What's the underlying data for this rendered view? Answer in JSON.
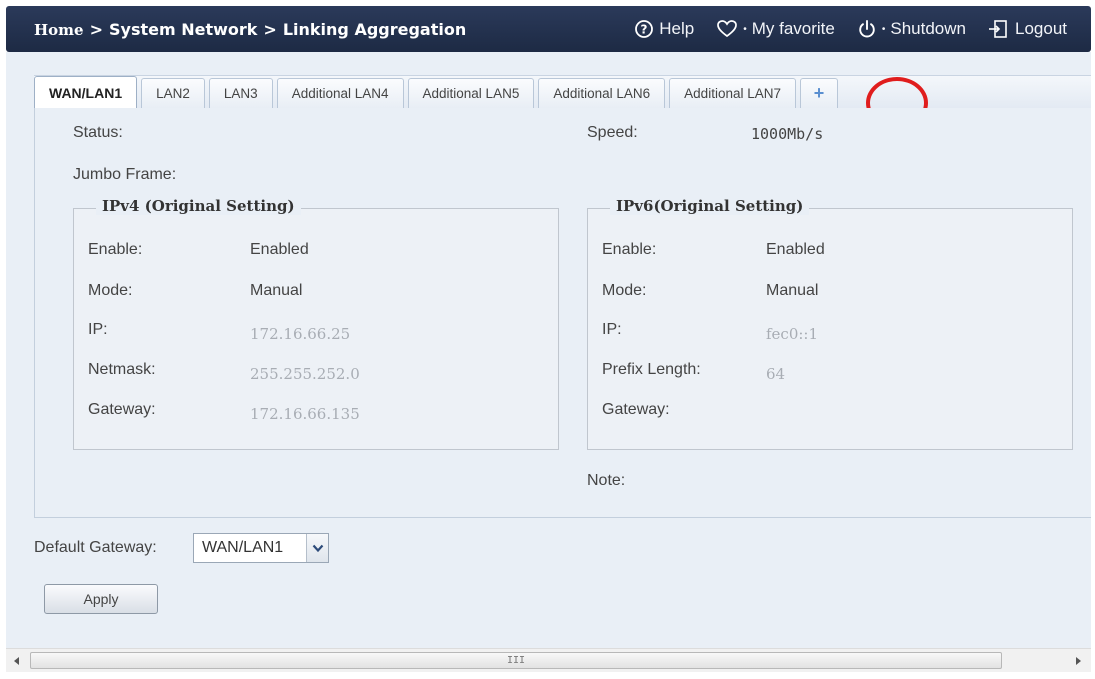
{
  "header": {
    "breadcrumb": {
      "home": "Home",
      "separator": ">",
      "section": "System Network",
      "page": "Linking Aggregation"
    },
    "actions": {
      "help": "Help",
      "favorite": "My favorite",
      "shutdown": "Shutdown",
      "logout": "Logout"
    }
  },
  "tabs": [
    {
      "label": "WAN/LAN1",
      "active": true
    },
    {
      "label": "LAN2"
    },
    {
      "label": "LAN3"
    },
    {
      "label": "Additional LAN4"
    },
    {
      "label": "Additional LAN5"
    },
    {
      "label": "Additional LAN6"
    },
    {
      "label": "Additional LAN7"
    },
    {
      "label": "+"
    }
  ],
  "panel": {
    "status_label": "Status:",
    "status_value": "",
    "speed_label": "Speed:",
    "speed_value": "1000Mb/s",
    "jumbo_label": "Jumbo Frame:",
    "jumbo_value": "",
    "note_label": "Note:",
    "ipv4": {
      "title": "IPv4 (Original Setting)",
      "enable_label": "Enable:",
      "enable_value": "Enabled",
      "mode_label": "Mode:",
      "mode_value": "Manual",
      "ip_label": "IP:",
      "ip_value": "172.16.66.25",
      "netmask_label": "Netmask:",
      "netmask_value": "255.255.252.0",
      "gateway_label": "Gateway:",
      "gateway_value": "172.16.66.135"
    },
    "ipv6": {
      "title": "IPv6(Original Setting)",
      "enable_label": "Enable:",
      "enable_value": "Enabled",
      "mode_label": "Mode:",
      "mode_value": "Manual",
      "ip_label": "IP:",
      "ip_value": "fec0::1",
      "prefix_label": "Prefix Length:",
      "prefix_value": "64",
      "gateway_label": "Gateway:",
      "gateway_value": ""
    }
  },
  "default_gateway": {
    "label": "Default Gateway:",
    "selected": "WAN/LAN1"
  },
  "apply_label": "Apply",
  "scrollbar": {
    "grip_label": "III"
  },
  "colors": {
    "header_bg": "#1d2a44",
    "content_bg": "#e9eff6",
    "highlight": "#e01d1d",
    "add_tab": "#5a8fd0"
  }
}
